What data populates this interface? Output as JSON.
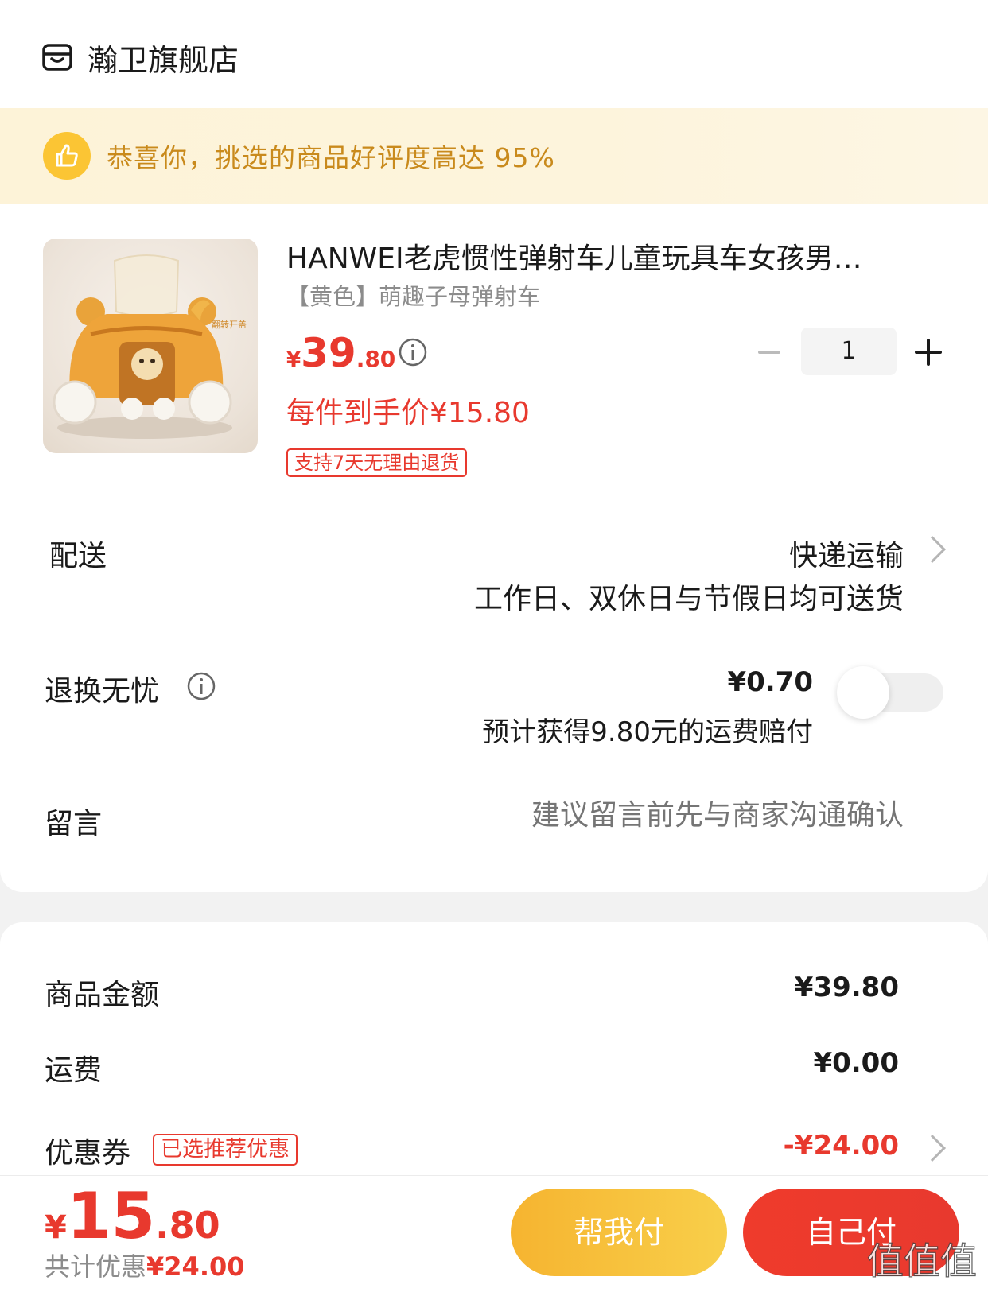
{
  "shop": {
    "name": "瀚卫旗舰店",
    "icon": "store-icon"
  },
  "banner": {
    "text": "恭喜你，挑选的商品好评度高达 95%",
    "icon": "thumbs-up-icon",
    "color": "#c98a1c"
  },
  "product": {
    "title": "HANWEI老虎惯性弹射车儿童玩具车女孩男…",
    "spec": "【黄色】萌趣子母弹射车",
    "price_yen": "¥",
    "price_int": "39",
    "price_dec": ".80",
    "final_price": "每件到手价¥15.80",
    "return_policy": "支持7天无理由退货",
    "quantity": "1",
    "image_label": "翻转开盖"
  },
  "delivery": {
    "label": "配送",
    "method": "快递运输",
    "note": "工作日、双休日与节假日均可送货"
  },
  "returns": {
    "label": "退换无忧",
    "price": "¥0.70",
    "note": "预计获得9.80元的运费赔付",
    "enabled": false
  },
  "message": {
    "label": "留言",
    "placeholder": "建议留言前先与商家沟通确认"
  },
  "summary": {
    "goods_label": "商品金额",
    "goods_value": "¥39.80",
    "shipping_label": "运费",
    "shipping_value": "¥0.00",
    "coupon_label": "优惠券",
    "coupon_badge": "已选推荐优惠",
    "coupon_value": "-¥24.00"
  },
  "footer": {
    "total_yen": "¥",
    "total_int": "15",
    "total_dec": ".80",
    "discount_label": "共计优惠",
    "discount_value": "¥24.00",
    "help_pay": "帮我付",
    "self_pay": "自己付",
    "watermark": "值值值",
    "watermark_url": "zhizhizhi.com"
  },
  "colors": {
    "accent": "#e8392e",
    "banner_bg": "#fdf3d8",
    "help_button": "#f6b430"
  }
}
